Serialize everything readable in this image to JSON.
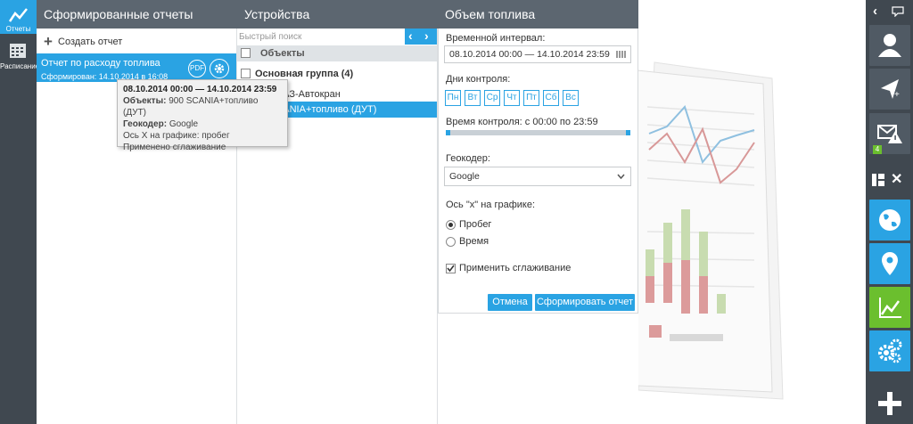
{
  "nav": {
    "reports_label": "Отчеты",
    "schedule_label": "Расписание"
  },
  "reports_panel": {
    "title": "Сформированные отчеты",
    "create_label": "Создать отчет",
    "report_title": "Отчет по расходу топлива",
    "report_sub": "Сформирован: 14.10.2014 в 16:08",
    "pdf_label": "PDF"
  },
  "tooltip": {
    "interval": "08.10.2014 00:00 — 14.10.2014 23:59",
    "objects_label": "Объекты:",
    "objects_value": "900 SCANIA+топливо (ДУТ)",
    "geocoder_label": "Геокодер:",
    "geocoder_value": "Google",
    "axis_line": "Ось X на графике: пробег",
    "smooth_line": "Применено сглаживание"
  },
  "devices_panel": {
    "title": "Устройства",
    "search_placeholder": "Быстрый поиск",
    "col_objects": "Объекты",
    "group_name": "Основная группа (4)",
    "item1": "МАЗ-Автокран",
    "item2": "SCANIA+топливо (ДУТ)"
  },
  "form": {
    "title": "Объем топлива",
    "interval_label": "Временной интервал:",
    "interval_value": "08.10.2014 00:00 — 14.10.2014 23:59",
    "days_label": "Дни контроля:",
    "days": [
      "Пн",
      "Вт",
      "Ср",
      "Чт",
      "Пт",
      "Сб",
      "Вс"
    ],
    "time_label": "Время контроля: с 00:00 по 23:59",
    "geocoder_label": "Геокодер:",
    "geocoder_value": "Google",
    "axis_label": "Ось \"x\" на графике:",
    "radio1": "Пробег",
    "radio2": "Время",
    "smooth_label": "Применить сглаживание",
    "cancel": "Отмена",
    "submit": "Сформировать отчет",
    "colors": {
      "accent": "#2aa3e3",
      "header": "#5c6670"
    }
  },
  "right_sidebar": {
    "badge_count": "4"
  }
}
